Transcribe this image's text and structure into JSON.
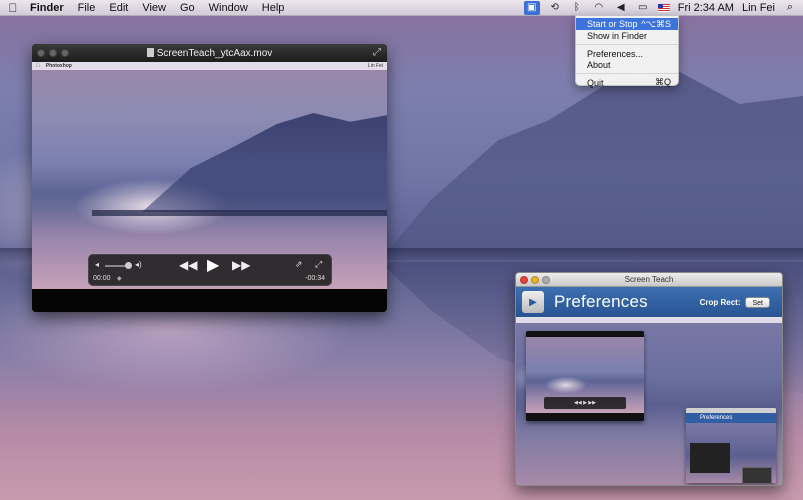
{
  "menubar": {
    "apple_icon": "apple-logo-icon",
    "app_name": "Finder",
    "menus": [
      "File",
      "Edit",
      "View",
      "Go",
      "Window",
      "Help"
    ],
    "status_icons": [
      "screen-teach-icon",
      "time-machine-icon",
      "bluetooth-icon",
      "wifi-icon",
      "volume-icon",
      "battery-icon"
    ],
    "clock": "Fri 2:34 AM",
    "user": "Lin Fei"
  },
  "status_menu": {
    "items": [
      {
        "label": "Start or Stop",
        "shortcut": "^⌥⌘S",
        "highlighted": true
      },
      {
        "label": "Show in Finder",
        "shortcut": ""
      },
      {
        "label": "Preferences...",
        "shortcut": ""
      },
      {
        "label": "About",
        "shortcut": ""
      },
      {
        "label": "Quit",
        "shortcut": "⌘Q"
      }
    ]
  },
  "player": {
    "title": "ScreenTeach_ytcAax.mov",
    "video_menubar": {
      "app": "Photoshop",
      "user": "Lin Fei"
    },
    "controls": {
      "current_time": "00:00",
      "remaining_time": "-00:34"
    }
  },
  "screen_teach": {
    "window_title": "Screen Teach",
    "heading": "Preferences",
    "crop_label": "Crop Rect:",
    "set_button": "Set",
    "mini_prefs_heading": "Preferences"
  },
  "colors": {
    "menu_highlight": "#3c73dd",
    "toolbar_blue": "#2f5ea5"
  }
}
